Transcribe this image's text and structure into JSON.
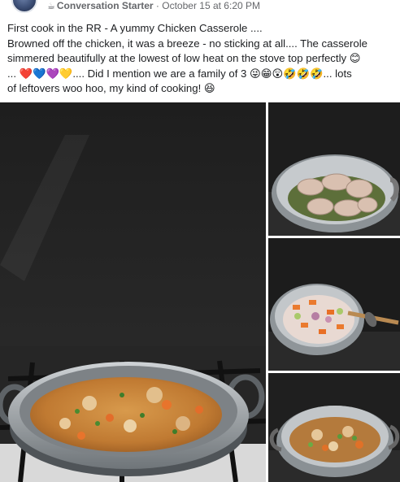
{
  "post": {
    "group_badge": "Conversation Starter",
    "separator": "·",
    "timestamp": "October 15 at 6:20 PM",
    "text_lines": [
      "First cook in the RR - A yummy Chicken Casserole ....",
      "Browned off the chicken, it was a breeze - no sticking at all.... The casserole",
      "simmered beautifully at the lowest of low heat on the stove top perfectly 😊",
      "... ❤️💙💜💛.... Did I mention we are a family of 3 😜😁😲🤣🤣🤣... lots",
      "of leftovers woo hoo, my kind of cooking! 😆"
    ]
  },
  "icons": {
    "group_badge_icon": "coffee-cup-icon",
    "avatar": "profile-avatar"
  },
  "colors": {
    "meta_text": "#65676b",
    "body_text": "#1c1e21",
    "countertop": "#2b2b2b",
    "pan": "#9aa0a6",
    "sauce": "#c98a3c"
  }
}
